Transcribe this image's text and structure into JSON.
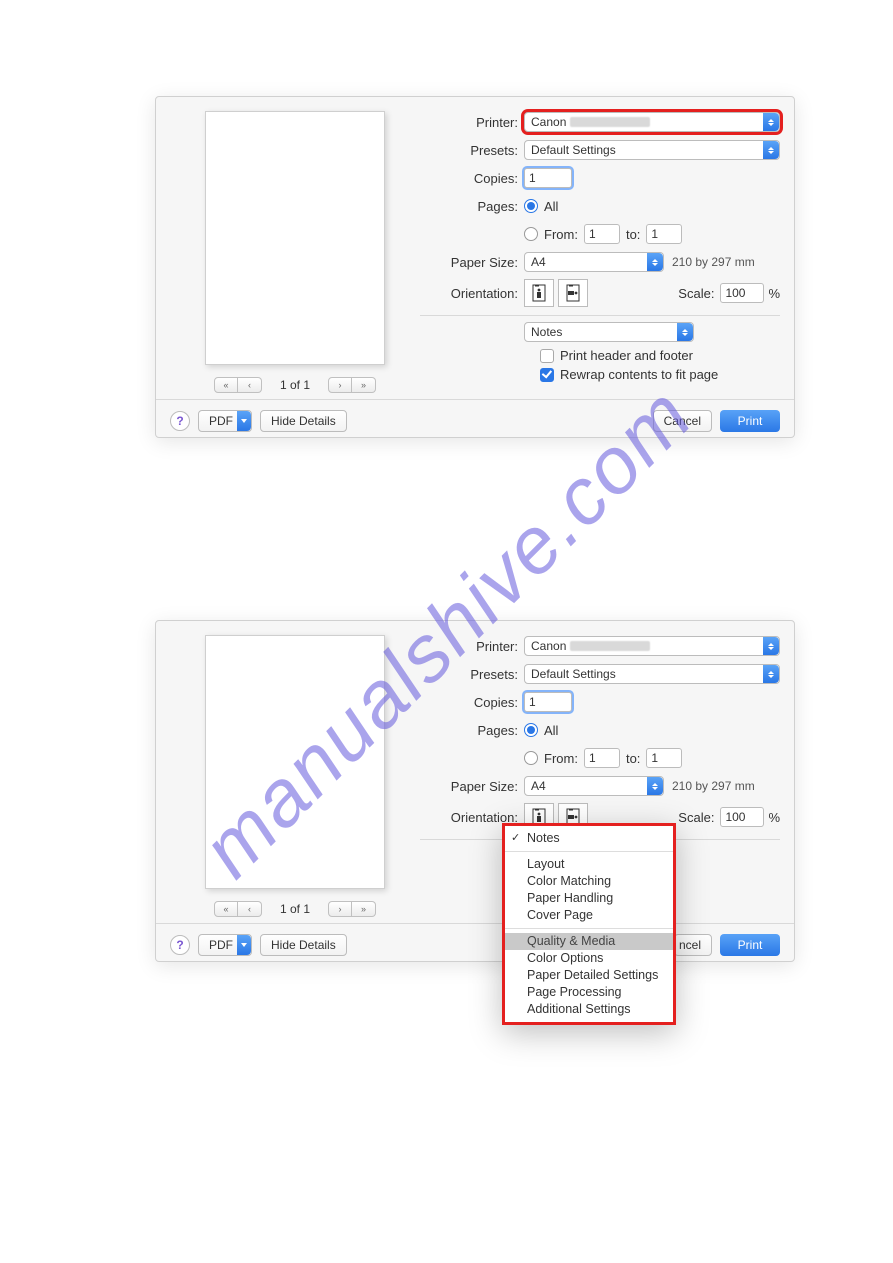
{
  "watermark": "manualshive.com",
  "labels": {
    "printer": "Printer:",
    "presets": "Presets:",
    "copies": "Copies:",
    "pages": "Pages:",
    "pages_all": "All",
    "pages_from": "From:",
    "pages_to": "to:",
    "paper_size": "Paper Size:",
    "paper_dim": "210 by 297 mm",
    "orientation": "Orientation:",
    "scale": "Scale:",
    "percent": "%",
    "page_count": "1 of 1",
    "print_hf": "Print header and footer",
    "rewrap": "Rewrap contents to fit page",
    "hide_details": "Hide Details",
    "cancel": "Cancel",
    "print": "Print",
    "pdf": "PDF",
    "help": "?"
  },
  "values": {
    "printer_prefix": "Canon",
    "presets": "Default Settings",
    "copies": "1",
    "page_from": "1",
    "page_to": "1",
    "paper_size": "A4",
    "scale": "100",
    "section_notes": "Notes",
    "hf_checked": false,
    "rewrap_checked": true
  },
  "menu": {
    "items_top": [
      "Notes"
    ],
    "items_mid": [
      "Layout",
      "Color Matching",
      "Paper Handling",
      "Cover Page"
    ],
    "items_bot": [
      "Quality & Media",
      "Color Options",
      "Paper Detailed Settings",
      "Page Processing",
      "Additional Settings"
    ],
    "selected": "Quality & Media",
    "checked": "Notes"
  }
}
